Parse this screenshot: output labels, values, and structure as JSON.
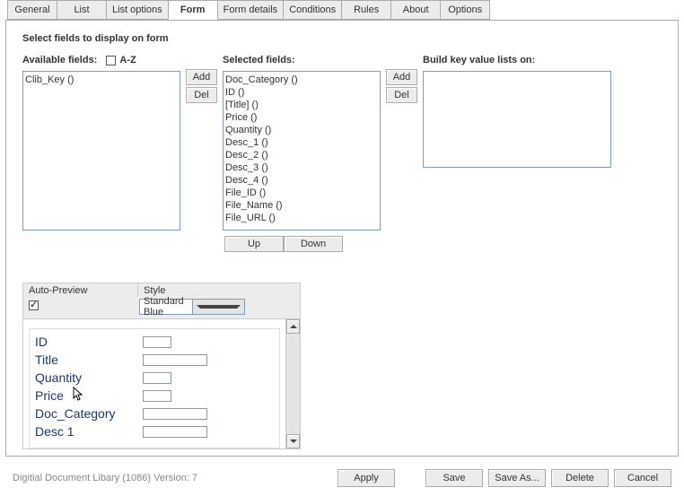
{
  "tabs": {
    "items": [
      {
        "label": "General"
      },
      {
        "label": "List"
      },
      {
        "label": "List options"
      },
      {
        "label": "Form"
      },
      {
        "label": "Form details"
      },
      {
        "label": "Conditions"
      },
      {
        "label": "Rules"
      },
      {
        "label": "About"
      },
      {
        "label": "Options"
      }
    ],
    "active_index": 3
  },
  "section_title": "Select fields to display on form",
  "available": {
    "label": "Available fields:",
    "az_label": "A-Z",
    "az_checked": false,
    "items": [
      "Clib_Key ()"
    ]
  },
  "add_label": "Add",
  "del_label": "Del",
  "selected": {
    "label": "Selected fields:",
    "items": [
      "Doc_Category ()",
      "ID ()",
      "[Title] ()",
      "Price ()",
      "Quantity ()",
      "Desc_1 ()",
      "Desc_2 ()",
      "Desc_3 ()",
      "Desc_4 ()",
      "File_ID ()",
      "File_Name ()",
      "File_URL ()"
    ]
  },
  "up_label": "Up",
  "down_label": "Down",
  "build": {
    "label": "Build key value lists on:",
    "items": []
  },
  "preview": {
    "auto_label": "Auto-Preview",
    "auto_checked": true,
    "style_label": "Style",
    "style_value": "Standard Blue",
    "rows": [
      {
        "label": "ID",
        "size": "small"
      },
      {
        "label": "Title",
        "size": "large"
      },
      {
        "label": "Quantity",
        "size": "small"
      },
      {
        "label": "Price",
        "size": "small"
      },
      {
        "label": "Doc_Category",
        "size": "large"
      },
      {
        "label": "Desc 1",
        "size": "large"
      }
    ]
  },
  "footer": {
    "status": "Digitial Document Libary (1086) Version: 7",
    "apply": "Apply",
    "save": "Save",
    "saveas": "Save As...",
    "delete": "Delete",
    "cancel": "Cancel"
  }
}
